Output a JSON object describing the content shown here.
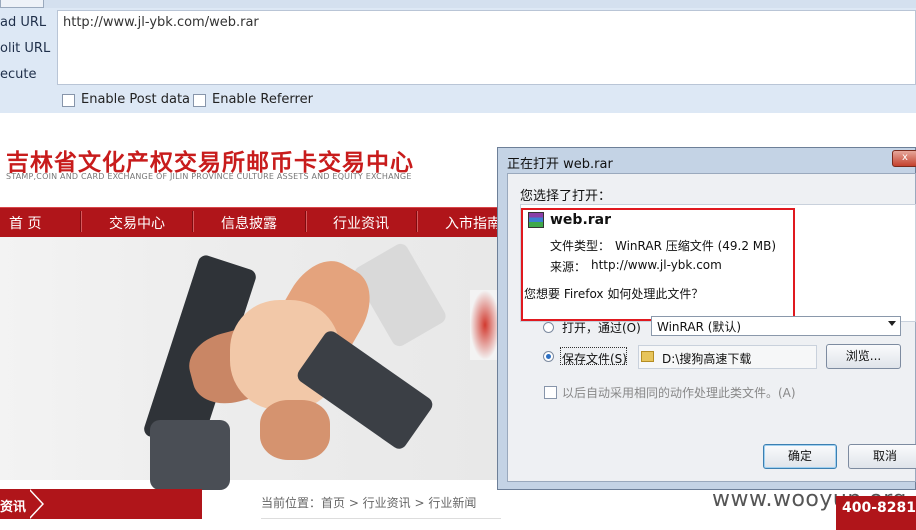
{
  "toolbar": {
    "load_url": "ad URL",
    "split_url": "olit URL",
    "execute": "ecute",
    "url_value": "http://www.jl-ybk.com/web.rar",
    "post_data": "Enable Post data",
    "referrer": "Enable Referrer"
  },
  "site": {
    "title": "吉林省文化产权交易所邮币卡交易中心",
    "subtitle": "STAMP,COIN AND CARD EXCHANGE OF JILIN PROVINCE CULTURE ASSETS AND EQUITY EXCHANGE",
    "nav": [
      "首 页",
      "交易中心",
      "信息披露",
      "行业资讯",
      "入市指南"
    ],
    "section_tab": "资讯",
    "breadcrumb": "当前位置：首页 > 行业资讯 > 行业新闻",
    "watermark": "www.wooyun.org",
    "phone": "400-8281-"
  },
  "dialog": {
    "title": "正在打开 web.rar",
    "close": "x",
    "chosen": "您选择了打开：",
    "file_name": "web.rar",
    "file_type_label": "文件类型：",
    "file_type": "WinRAR 压缩文件 (49.2 MB)",
    "source_label": "来源：",
    "source": "http://www.jl-ybk.com",
    "ask": "您想要 Firefox 如何处理此文件？",
    "open_with": "打开，通过(O)",
    "app": "WinRAR (默认)",
    "save_file": "保存文件(S)",
    "save_path": "D:\\搜狗高速下载",
    "browse": "浏览...",
    "remember": "以后自动采用相同的动作处理此类文件。(A)",
    "ok": "确定",
    "cancel": "取消"
  },
  "colors": {
    "brand_red": "#b0151a",
    "highlight_red": "#e0191f",
    "toolbar_bg": "#dde8f5"
  }
}
